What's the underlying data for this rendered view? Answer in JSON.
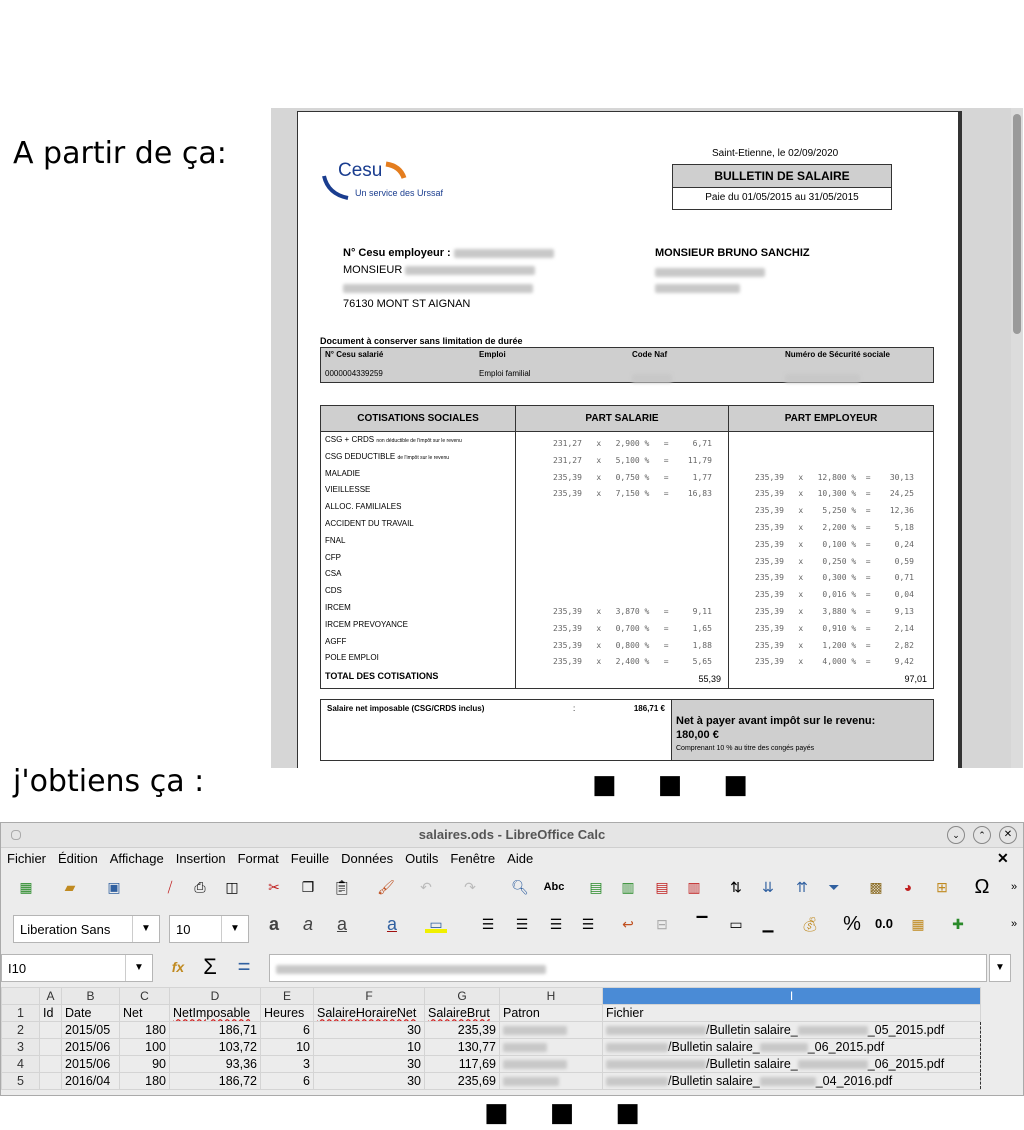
{
  "captions": {
    "before": "A partir de ça:",
    "after": "j'obtiens ça :",
    "ellipsis": "■ ■ ■"
  },
  "pdf": {
    "logo": {
      "brand": "Cesu",
      "tagline": "Un service des Urssaf"
    },
    "place_date": "Saint-Etienne, le 02/09/2020",
    "doc_title": "BULLETIN DE SALAIRE",
    "period": "Paie du 01/05/2015 au 31/05/2015",
    "employer_label": "N° Cesu employeur :",
    "employer_name": "MONSIEUR",
    "employer_city": "76130 MONT ST AIGNAN",
    "employee_name": "MONSIEUR BRUNO SANCHIZ",
    "keep_notice": "Document à conserver sans limitation de durée",
    "id_headers": [
      "N° Cesu salarié",
      "Emploi",
      "Code Naf",
      "Numéro de Sécurité sociale"
    ],
    "id_values": [
      "0000004339259",
      "Emploi familial"
    ],
    "cot_headers": [
      "COTISATIONS SOCIALES",
      "PART SALARIE",
      "PART EMPLOYEUR"
    ],
    "rows": [
      {
        "label": "CSG + CRDS",
        "note": "non déductible de l'impôt sur le revenu",
        "sal": "231,27   x   2,900 %   =     6,71",
        "emp": ""
      },
      {
        "label": "CSG DEDUCTIBLE",
        "note": "de l'impôt sur le revenu",
        "sal": "231,27   x   5,100 %   =    11,79",
        "emp": ""
      },
      {
        "label": "MALADIE",
        "note": "",
        "sal": "235,39   x   0,750 %   =     1,77",
        "emp": "235,39   x   12,800 %  =    30,13"
      },
      {
        "label": "VIEILLESSE",
        "note": "",
        "sal": "235,39   x   7,150 %   =    16,83",
        "emp": "235,39   x   10,300 %  =    24,25"
      },
      {
        "label": "ALLOC. FAMILIALES",
        "note": "",
        "sal": "",
        "emp": "235,39   x    5,250 %  =    12,36"
      },
      {
        "label": "ACCIDENT DU TRAVAIL",
        "note": "",
        "sal": "",
        "emp": "235,39   x    2,200 %  =     5,18"
      },
      {
        "label": "FNAL",
        "note": "",
        "sal": "",
        "emp": "235,39   x    0,100 %  =     0,24"
      },
      {
        "label": "CFP",
        "note": "",
        "sal": "",
        "emp": "235,39   x    0,250 %  =     0,59"
      },
      {
        "label": "CSA",
        "note": "",
        "sal": "",
        "emp": "235,39   x    0,300 %  =     0,71"
      },
      {
        "label": "CDS",
        "note": "",
        "sal": "",
        "emp": "235,39   x    0,016 %  =     0,04"
      },
      {
        "label": "IRCEM",
        "note": "",
        "sal": "235,39   x   3,870 %   =     9,11",
        "emp": "235,39   x    3,880 %  =     9,13"
      },
      {
        "label": "IRCEM PREVOYANCE",
        "note": "",
        "sal": "235,39   x   0,700 %   =     1,65",
        "emp": "235,39   x    0,910 %  =     2,14"
      },
      {
        "label": "AGFF",
        "note": "",
        "sal": "235,39   x   0,800 %   =     1,88",
        "emp": "235,39   x    1,200 %  =     2,82"
      },
      {
        "label": "POLE EMPLOI",
        "note": "",
        "sal": "235,39   x   2,400 %   =     5,65",
        "emp": "235,39   x    4,000 %  =     9,42"
      }
    ],
    "total_label": "TOTAL DES COTISATIONS",
    "total_sal": "55,39",
    "total_emp": "97,01",
    "net_imposable_label": "Salaire net imposable (CSG/CRDS inclus)",
    "net_imposable_sep": ":",
    "net_imposable_value": "186,71 €",
    "net_pay_label": "Net à payer avant impôt sur le revenu:",
    "net_pay_value": "180,00 €",
    "net_pay_note": "Comprenant 10 % au titre des congés payés"
  },
  "calc": {
    "title": "salaires.ods - LibreOffice Calc",
    "menus": [
      "Fichier",
      "Édition",
      "Affichage",
      "Insertion",
      "Format",
      "Feuille",
      "Données",
      "Outils",
      "Fenêtre",
      "Aide"
    ],
    "font_name": "Liberation Sans",
    "font_size": "10",
    "cell_ref": "I10",
    "percent_label": "%",
    "decimal_label": "0.0",
    "sum_icon": "Σ",
    "equals_icon": "=",
    "col_headers": [
      "A",
      "B",
      "C",
      "D",
      "E",
      "F",
      "G",
      "H",
      "I"
    ],
    "header_row": [
      "Id",
      "Date",
      "Net",
      "NetImposable",
      "Heures",
      "SalaireHoraireNet",
      "SalaireBrut",
      "Patron",
      "Fichier"
    ],
    "rows": [
      {
        "n": "2",
        "date": "2015/05",
        "net": "180",
        "netimp": "186,71",
        "heures": "6",
        "shn": "30",
        "brut": "235,39",
        "file_mid": "/Bulletin salaire_",
        "file_end": "_05_2015.pdf"
      },
      {
        "n": "3",
        "date": "2015/06",
        "net": "100",
        "netimp": "103,72",
        "heures": "10",
        "shn": "10",
        "brut": "130,77",
        "file_mid": "/Bulletin salaire_",
        "file_end": "_06_2015.pdf"
      },
      {
        "n": "4",
        "date": "2015/06",
        "net": "90",
        "netimp": "93,36",
        "heures": "3",
        "shn": "30",
        "brut": "117,69",
        "file_mid": "/Bulletin salaire_",
        "file_end": "_06_2015.pdf"
      },
      {
        "n": "5",
        "date": "2016/04",
        "net": "180",
        "netimp": "186,72",
        "heures": "6",
        "shn": "30",
        "brut": "235,69",
        "file_mid": "/Bulletin salaire_",
        "file_end": "_04_2016.pdf"
      }
    ],
    "row1_n": "1"
  }
}
